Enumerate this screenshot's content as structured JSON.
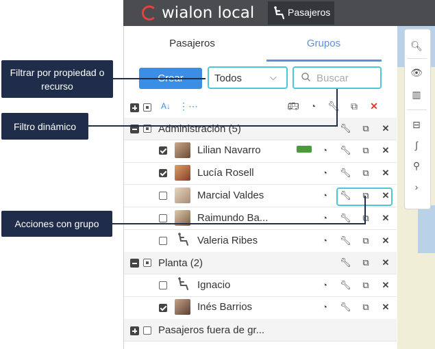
{
  "app": {
    "logo_text": "wialon local",
    "active_app": "Pasajeros"
  },
  "tabs": [
    {
      "label": "Pasajeros",
      "active": false
    },
    {
      "label": "Grupos",
      "active": true
    }
  ],
  "controls": {
    "create_label": "Crear",
    "filter_value": "Todos",
    "search_placeholder": "Buscar"
  },
  "groups": [
    {
      "name": "Administración (5)",
      "expanded": true,
      "members": [
        {
          "name": "Lilian Navarro",
          "checked": true,
          "avatar": "photo",
          "has_vehicle": true
        },
        {
          "name": "Lucía Rosell",
          "checked": true,
          "avatar": "photo"
        },
        {
          "name": "Marcial Valdes",
          "checked": false,
          "avatar": "photo",
          "highlighted_actions": true
        },
        {
          "name": "Raimundo Ba...",
          "checked": false,
          "avatar": "photo"
        },
        {
          "name": "Valeria Ribes",
          "checked": false,
          "avatar": "seat-icon"
        }
      ]
    },
    {
      "name": "Planta (2)",
      "expanded": true,
      "members": [
        {
          "name": "Ignacio",
          "checked": false,
          "avatar": "seat-icon"
        },
        {
          "name": "Inés Barrios",
          "checked": true,
          "avatar": "photo"
        }
      ]
    },
    {
      "name": "Pasajeros fuera de gr...",
      "expanded": false,
      "members": []
    }
  ],
  "callouts": {
    "filter": "Filtrar por propiedad o recurso",
    "dynamic": "Filtro dinámico",
    "group_actions": "Acciones con grupo"
  },
  "colors": {
    "accent": "#3a8ee6",
    "highlight": "#4fc6d4",
    "callout": "#1f2d4a",
    "delete": "#e0392e"
  }
}
